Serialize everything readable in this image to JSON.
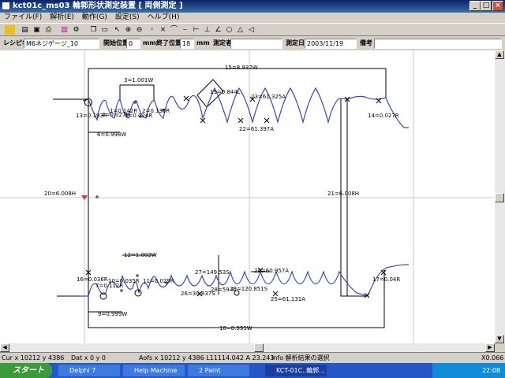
{
  "window": {
    "title": "kct01c_ms03  輪郭形状測定装置 [ 両側測定 ]",
    "minimize": "_",
    "maximize": "□",
    "close": "×"
  },
  "menu": [
    "ファイル(F)",
    "解析(E)",
    "動作(G)",
    "設定(S)",
    "ヘルプ(H)"
  ],
  "params": {
    "recipe_label": "レシピ名",
    "recipe_value": "M6ネジゲージ_10",
    "start_label": "開始位置",
    "start_value": "0",
    "start_unit": "mm",
    "end_label": "終了位置",
    "end_value": "18",
    "end_unit": "mm",
    "operator_label": "測定者",
    "operator_value": "",
    "date_label": "測定日",
    "date_value": "2003/11/19",
    "note_label": "備考",
    "note_value": ""
  },
  "labels": {
    "l15": "15=8.937W",
    "l3": "3=1.001W",
    "l19": "19=0.844L",
    "l23": "23=61.325A",
    "l1": "1=0.142R",
    "l2": "2=0.135R",
    "l13": "13=0.193R",
    "l4": "4=0.027R",
    "l5": "5=0.024R",
    "l14": "14=0.027R",
    "l22": "22=61.397A",
    "l6": "6=0.998W",
    "l20": "20=6.008H",
    "l21": "21=6.008H",
    "l12": "12=1.002W",
    "l16": "16=0.036R",
    "l10": "10=0.035R",
    "l11": "11=0.029R",
    "l7": "7=0.112R",
    "l27": "27=149.53S",
    "l24": "24=60.957A",
    "l28": "28=59.8",
    "l29": "29=120.851S",
    "l26": "26=30.837S",
    "l25": "25=61.131A",
    "l17": "17=0.04R",
    "l9": "9=0.999W",
    "l18": "18=8.995W"
  },
  "status": {
    "cur": "Cur   x 10212 y  4386",
    "dat": "Dat   x      0 y      0",
    "aofs": "Aofs  x 10212 y   4386 L11114.042 A 23.243",
    "info": "Info   解析結果の選択",
    "zoom": "X0.066"
  },
  "taskbar": {
    "start": "スタート",
    "tasks": [
      "Delphi 7",
      "Help Machine",
      "2 Paint",
      "KCT-01C..輪郭..."
    ],
    "clock": "22:08"
  }
}
